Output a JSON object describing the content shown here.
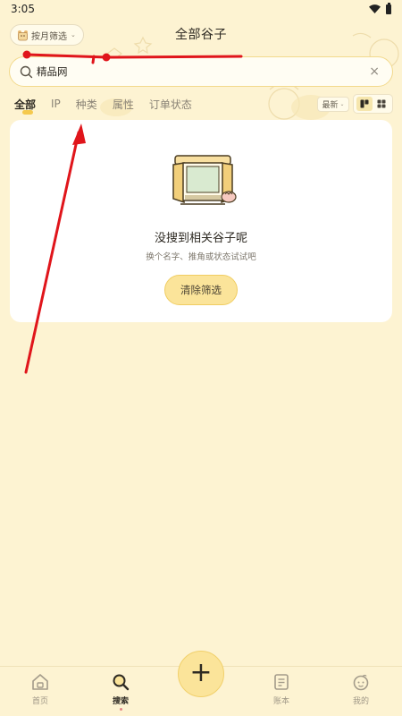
{
  "status_bar": {
    "time": "3:05"
  },
  "header": {
    "title": "全部谷子",
    "month_filter_label": "按月筛选",
    "month_filter_icon": "bear-calendar-icon"
  },
  "search": {
    "value": "精品网",
    "clear_symbol": "×"
  },
  "tabs": [
    {
      "label": "全部",
      "active": true
    },
    {
      "label": "IP",
      "active": false
    },
    {
      "label": "种类",
      "active": false
    },
    {
      "label": "属性",
      "active": false
    },
    {
      "label": "订单状态",
      "active": false
    }
  ],
  "sort": {
    "label": "最新"
  },
  "view_toggle": {
    "active": "waterfall"
  },
  "empty_state": {
    "title": "没搜到相关谷子呢",
    "subtitle": "换个名字、推角或状态试试吧",
    "button_label": "清除筛选"
  },
  "bottom_nav": {
    "items": [
      {
        "label": "首页",
        "icon": "home-icon",
        "active": false
      },
      {
        "label": "搜索",
        "icon": "search-icon",
        "active": true
      },
      {
        "label": "账本",
        "icon": "ledger-icon",
        "active": false
      },
      {
        "label": "我的",
        "icon": "profile-icon",
        "active": false
      }
    ],
    "fab_symbol": "+"
  },
  "colors": {
    "background": "#fdf3d2",
    "accent": "#fbe49a",
    "accent_border": "#f1d06b",
    "annotation": "#e0151b"
  }
}
